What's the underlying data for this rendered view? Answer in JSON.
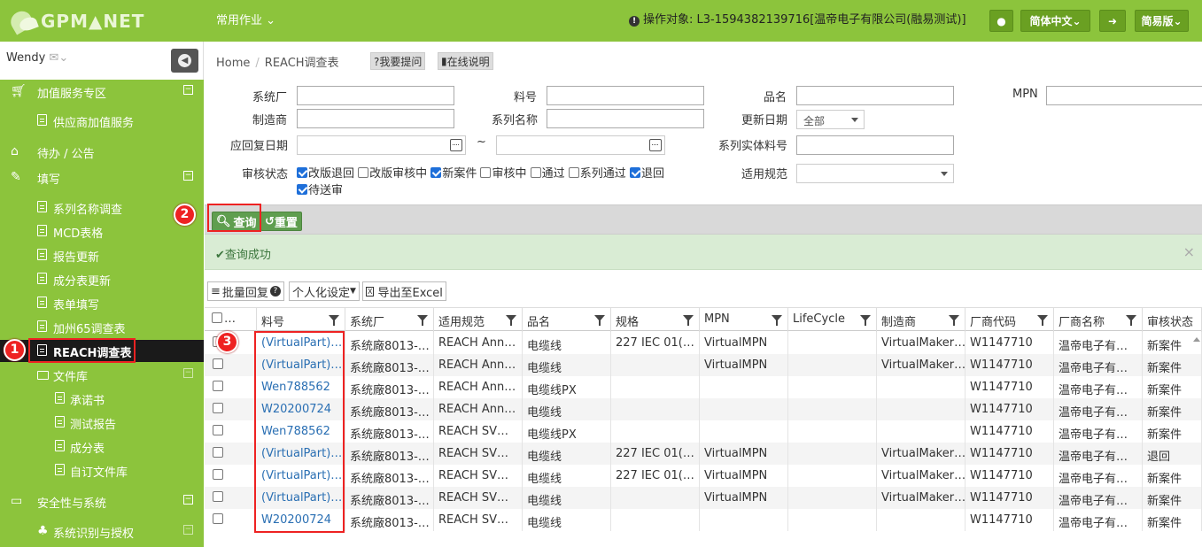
{
  "header": {
    "logo_text": "GPM▲NET",
    "top_menu": "常用作业",
    "operation_target": "操作对象: L3-1594382139716[温帝电子有限公司(融易测试)]",
    "language": "简体中文",
    "mode": "简易版"
  },
  "user": {
    "name": "Wendy"
  },
  "sidebar": {
    "items": [
      {
        "label": "加值服务专区"
      },
      {
        "label": "供应商加值服务"
      },
      {
        "label": "待办 / 公告"
      },
      {
        "label": "填写"
      },
      {
        "label": "系列名称调查"
      },
      {
        "label": "MCD表格"
      },
      {
        "label": "报告更新"
      },
      {
        "label": "成分表更新"
      },
      {
        "label": "表单填写"
      },
      {
        "label": "加州65调查表"
      },
      {
        "label": "REACH调查表"
      },
      {
        "label": "文件库"
      },
      {
        "label": "承诺书"
      },
      {
        "label": "测试报告"
      },
      {
        "label": "成分表"
      },
      {
        "label": "自订文件库"
      },
      {
        "label": "安全性与系统"
      },
      {
        "label": "系统识别与授权"
      }
    ]
  },
  "breadcrumb": {
    "home": "Home",
    "current": "REACH调查表"
  },
  "help": {
    "ask": "?我要提问",
    "online": "在线说明"
  },
  "form": {
    "system_factory": "系统厂",
    "part_no": "料号",
    "product_name": "品名",
    "mpn": "MPN",
    "manufacturer": "制造商",
    "series_name": "系列名称",
    "update_date": "更新日期",
    "update_date_value": "全部",
    "reply_date": "应回复日期",
    "tilde": "~",
    "series_entity": "系列实体料号",
    "audit_status": "审核状态",
    "applicable_spec": "适用规范",
    "statuses": [
      {
        "label": "改版退回",
        "checked": true
      },
      {
        "label": "改版审核中",
        "checked": false
      },
      {
        "label": "新案件",
        "checked": true
      },
      {
        "label": "审核中",
        "checked": false
      },
      {
        "label": "通过",
        "checked": false
      },
      {
        "label": "系列通过",
        "checked": false
      },
      {
        "label": "退回",
        "checked": true
      },
      {
        "label": "待送审",
        "checked": true
      }
    ]
  },
  "actions": {
    "query": "查询",
    "reset": "重置"
  },
  "alert": {
    "message": "查询成功",
    "close": "×"
  },
  "toolbar": {
    "batch_reply": "批量回复",
    "personalize": "个人化设定",
    "export": "导出至Excel"
  },
  "annotations": {
    "one": "1",
    "two": "2",
    "three": "3"
  },
  "grid": {
    "headers": [
      "…",
      "料号",
      "系统厂",
      "适用规范",
      "品名",
      "规格",
      "MPN",
      "LifeCycle",
      "制造商",
      "厂商代码",
      "厂商名称",
      "审核状态"
    ],
    "rows": [
      [
        "(VirtualPart)…",
        "系统廠8013-…",
        "REACH Ann…",
        "电缆线",
        "227 IEC 01(…",
        "VirtualMPN",
        "",
        "VirtualMaker…",
        "W1147710",
        "温帝电子有…",
        "新案件"
      ],
      [
        "(VirtualPart)…",
        "系统廠8013-…",
        "REACH Ann…",
        "电缆线",
        "",
        "VirtualMPN",
        "",
        "VirtualMaker…",
        "W1147710",
        "温帝电子有…",
        "新案件"
      ],
      [
        "Wen788562",
        "系统廠8013-…",
        "REACH Ann…",
        "电缆线PX",
        "",
        "",
        "",
        "",
        "W1147710",
        "温帝电子有…",
        "新案件"
      ],
      [
        "W20200724",
        "系统廠8013-…",
        "REACH Ann…",
        "电缆线",
        "",
        "",
        "",
        "",
        "W1147710",
        "温帝电子有…",
        "新案件"
      ],
      [
        "Wen788562",
        "系统廠8013-…",
        "REACH SV…",
        "电缆线PX",
        "",
        "",
        "",
        "",
        "W1147710",
        "温帝电子有…",
        "新案件"
      ],
      [
        "(VirtualPart)…",
        "系统廠8013-…",
        "REACH SV…",
        "电缆线",
        "227 IEC 01(…",
        "VirtualMPN",
        "",
        "VirtualMaker…",
        "W1147710",
        "温帝电子有…",
        "退回"
      ],
      [
        "(VirtualPart)…",
        "系统廠8013-…",
        "REACH SV…",
        "电缆线",
        "227 IEC 01(…",
        "VirtualMPN",
        "",
        "VirtualMaker…",
        "W1147710",
        "温帝电子有…",
        "新案件"
      ],
      [
        "(VirtualPart)…",
        "系统廠8013-…",
        "REACH SV…",
        "电缆线",
        "",
        "VirtualMPN",
        "",
        "VirtualMaker…",
        "W1147710",
        "温帝电子有…",
        "新案件"
      ],
      [
        "W20200724",
        "系统廠8013-…",
        "REACH SV…",
        "电缆线",
        "",
        "",
        "",
        "",
        "W1147710",
        "温帝电子有…",
        "新案件"
      ]
    ]
  },
  "colors": {
    "brand_green": "#8cc43c",
    "annotation_red": "#e22222",
    "link_blue": "#2a6fb3"
  }
}
